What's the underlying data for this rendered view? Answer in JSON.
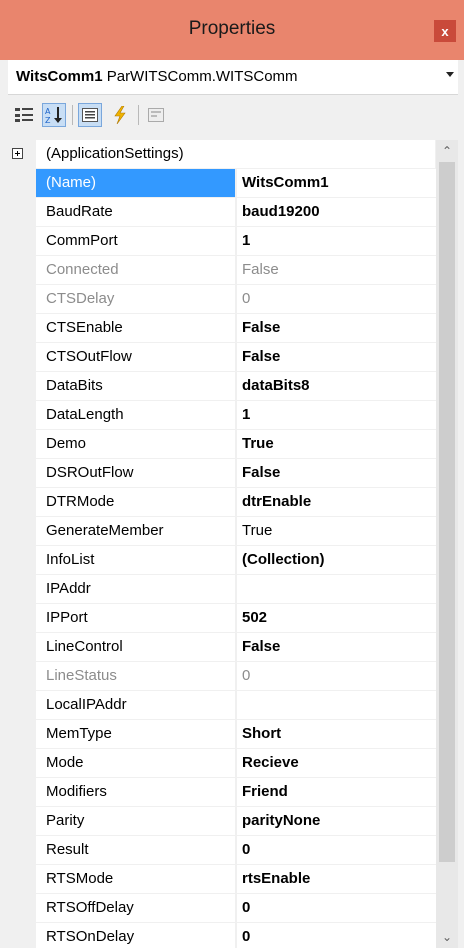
{
  "window": {
    "title": "Properties",
    "close_glyph": "x"
  },
  "object_selector": {
    "name": "WitsComm1",
    "type": "ParWITSComm.WITSComm"
  },
  "toolbar": {
    "buttons": [
      {
        "icon": "categorized-icon"
      },
      {
        "icon": "alphabetical-icon"
      },
      {
        "icon": "properties-icon"
      },
      {
        "icon": "events-icon"
      },
      {
        "icon": "property-pages-icon"
      }
    ]
  },
  "category": {
    "label": "(ApplicationSettings)"
  },
  "properties": [
    {
      "name": "(Name)",
      "value": "WitsComm1",
      "bold": true,
      "selected": true
    },
    {
      "name": "BaudRate",
      "value": "baud19200",
      "bold": true
    },
    {
      "name": "CommPort",
      "value": "1",
      "bold": true
    },
    {
      "name": "Connected",
      "value": "False",
      "disabled": true
    },
    {
      "name": "CTSDelay",
      "value": "0",
      "disabled": true
    },
    {
      "name": "CTSEnable",
      "value": "False",
      "bold": true
    },
    {
      "name": "CTSOutFlow",
      "value": "False",
      "bold": true
    },
    {
      "name": "DataBits",
      "value": "dataBits8",
      "bold": true
    },
    {
      "name": "DataLength",
      "value": "1",
      "bold": true
    },
    {
      "name": "Demo",
      "value": "True",
      "bold": true
    },
    {
      "name": "DSROutFlow",
      "value": "False",
      "bold": true
    },
    {
      "name": "DTRMode",
      "value": "dtrEnable",
      "bold": true
    },
    {
      "name": "GenerateMember",
      "value": "True"
    },
    {
      "name": "InfoList",
      "value": "(Collection)",
      "bold": true
    },
    {
      "name": "IPAddr",
      "value": ""
    },
    {
      "name": "IPPort",
      "value": "502",
      "bold": true
    },
    {
      "name": "LineControl",
      "value": "False",
      "bold": true
    },
    {
      "name": "LineStatus",
      "value": "0",
      "disabled": true
    },
    {
      "name": "LocalIPAddr",
      "value": ""
    },
    {
      "name": "MemType",
      "value": "Short",
      "bold": true
    },
    {
      "name": "Mode",
      "value": "Recieve",
      "bold": true
    },
    {
      "name": "Modifiers",
      "value": "Friend",
      "bold": true
    },
    {
      "name": "Parity",
      "value": "parityNone",
      "bold": true
    },
    {
      "name": "Result",
      "value": "0",
      "bold": true
    },
    {
      "name": "RTSMode",
      "value": "rtsEnable",
      "bold": true
    },
    {
      "name": "RTSOffDelay",
      "value": "0",
      "bold": true
    },
    {
      "name": "RTSOnDelay",
      "value": "0",
      "bold": true
    }
  ]
}
